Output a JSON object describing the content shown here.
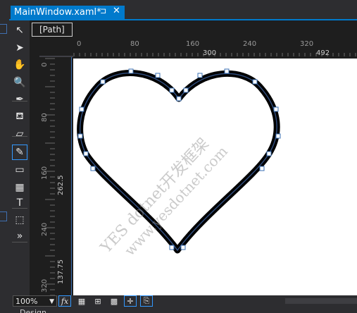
{
  "tab": {
    "title": "MainWindow.xaml*",
    "pin_glyph": "⊐",
    "close_glyph": "✕"
  },
  "breadcrumb": {
    "label": "[Path]"
  },
  "hruler": {
    "labels": [
      "0",
      "80",
      "160",
      "240",
      "320"
    ],
    "top_labels": [
      "300",
      "492"
    ]
  },
  "vruler": {
    "labels": [
      "0",
      "80",
      "160",
      "240",
      "320"
    ],
    "side_labels": [
      "262.5",
      "137.75"
    ]
  },
  "toolbox": {
    "tools": [
      {
        "name": "selection-tool",
        "icon": "pointer-outline-icon",
        "glyph": "↖"
      },
      {
        "name": "direct-selection-tool",
        "icon": "pointer-solid-icon",
        "glyph": "➤"
      },
      {
        "name": "pan-tool",
        "icon": "hand-icon",
        "glyph": "✋"
      },
      {
        "name": "zoom-tool",
        "icon": "magnifier-icon",
        "glyph": "🔍"
      },
      {
        "name": "eyedropper-tool",
        "icon": "eyedropper-icon",
        "glyph": "✒"
      },
      {
        "name": "paint-bucket-tool",
        "icon": "paint-bucket-icon",
        "glyph": "⛾"
      },
      {
        "name": "eraser-tool",
        "icon": "eraser-icon",
        "glyph": "▱"
      },
      {
        "name": "pen-tool",
        "icon": "pen-icon",
        "glyph": "✎"
      },
      {
        "name": "rectangle-tool",
        "icon": "rectangle-icon",
        "glyph": "▭"
      },
      {
        "name": "grid-tool",
        "icon": "grid-icon",
        "glyph": "▦"
      },
      {
        "name": "text-tool",
        "icon": "text-icon",
        "glyph": "T"
      },
      {
        "name": "assets-tool",
        "icon": "assets-icon",
        "glyph": "⬚"
      },
      {
        "name": "more-tools",
        "icon": "chevron-right-double-icon",
        "glyph": "»"
      }
    ],
    "active_tool": "pen-tool"
  },
  "bottom_bar": {
    "zoom": "100%",
    "buttons": [
      {
        "name": "formula-button",
        "icon": "fx-icon",
        "glyph": "fx",
        "boxed": true
      },
      {
        "name": "grid-view-button",
        "icon": "grid-view-icon",
        "glyph": "▦",
        "boxed": false
      },
      {
        "name": "snap-grid-button",
        "icon": "snap-grid-icon",
        "glyph": "⊞",
        "boxed": false
      },
      {
        "name": "checker-button",
        "icon": "checkerboard-icon",
        "glyph": "▩",
        "boxed": false
      },
      {
        "name": "snap-lines-button",
        "icon": "snap-lines-icon",
        "glyph": "✛",
        "boxed": true
      },
      {
        "name": "annotations-button",
        "icon": "annotation-icon",
        "glyph": "⎘",
        "boxed": true
      }
    ],
    "bottom_tabs_text": "Design"
  },
  "watermark": {
    "line1": "YES dotnet开发框架",
    "line2": "www.yesdotnet.com"
  },
  "colors": {
    "accent": "#007acc",
    "heart_stroke": "#000000",
    "heart_inner": "#2f4b7a",
    "node_fill": "#ffffff",
    "node_stroke": "#3a6fb3"
  }
}
